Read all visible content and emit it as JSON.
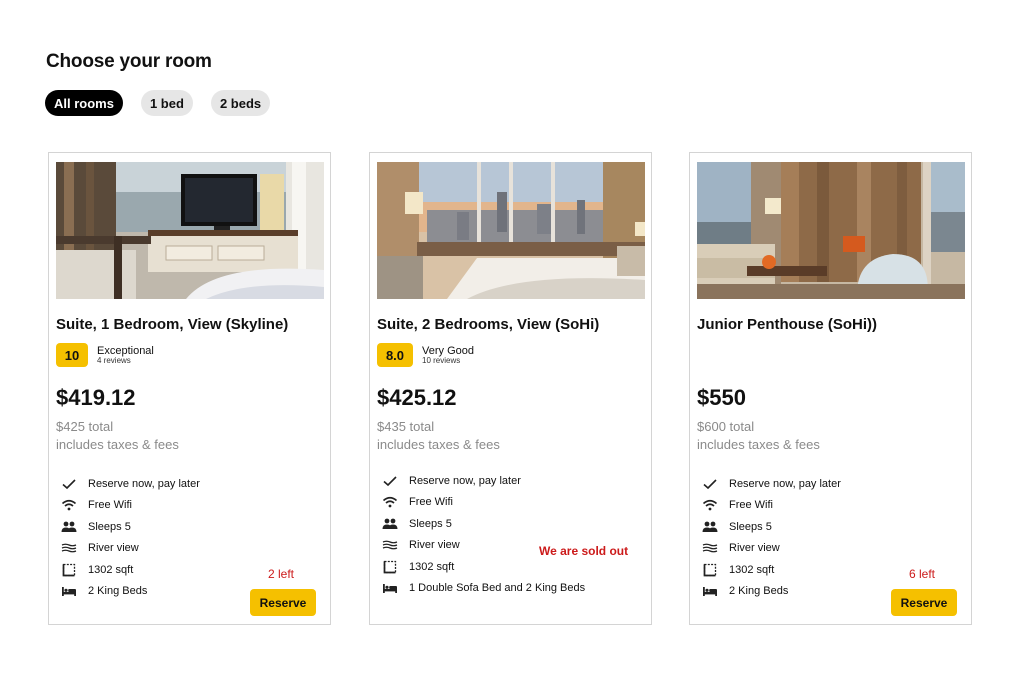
{
  "header": {
    "title": "Choose your room"
  },
  "filters": [
    {
      "label": "All rooms",
      "active": true
    },
    {
      "label": "1 bed",
      "active": false
    },
    {
      "label": "2 beds",
      "active": false
    }
  ],
  "rooms": [
    {
      "name": "Suite, 1 Bedroom, View (Skyline)",
      "rating": {
        "score": "10",
        "label": "Exceptional",
        "reviews": "4 reviews"
      },
      "price": "$419.12",
      "total": "$425 total",
      "taxes": "includes taxes & fees",
      "features": [
        "Reserve now, pay later",
        "Free Wifi",
        "Sleeps 5",
        "River view",
        "1302 sqft",
        "2 King Beds"
      ],
      "availability": "2 left",
      "reserve_label": "Reserve"
    },
    {
      "name": "Suite, 2 Bedrooms, View (SoHi)",
      "rating": {
        "score": "8.0",
        "label": "Very Good",
        "reviews": "10 reviews"
      },
      "price": "$425.12",
      "total": "$435 total",
      "taxes": "includes taxes & fees",
      "features": [
        "Reserve now, pay later",
        "Free Wifi",
        "Sleeps 5",
        "River view",
        "1302 sqft",
        "1 Double Sofa Bed and 2 King Beds"
      ],
      "sold_out": "We are sold out"
    },
    {
      "name": "Junior Penthouse (SoHi))",
      "price": "$550",
      "total": "$600 total",
      "taxes": "includes taxes & fees",
      "features": [
        "Reserve now, pay later",
        "Free Wifi",
        "Sleeps 5",
        "River view",
        "1302 sqft",
        "2 King Beds"
      ],
      "availability": "6 left",
      "reserve_label": "Reserve"
    }
  ],
  "feature_icons": [
    "check-icon",
    "wifi-icon",
    "people-icon",
    "waves-icon",
    "area-icon",
    "bed-icon"
  ],
  "colors": {
    "accent": "#f5c000",
    "alert": "#cc1a1a",
    "muted": "#8a8a8a"
  }
}
